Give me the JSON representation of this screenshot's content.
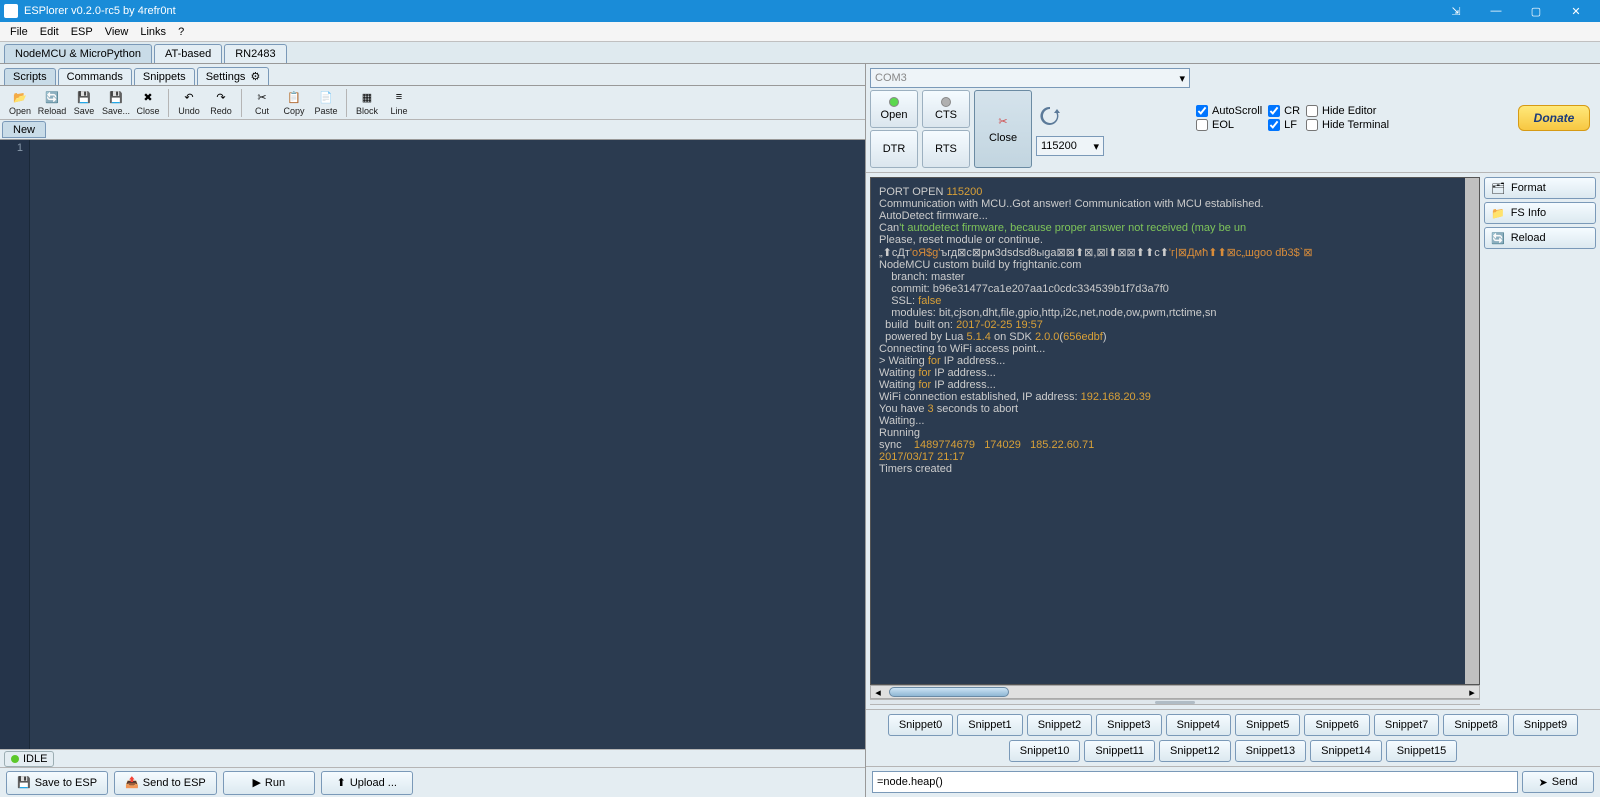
{
  "app": {
    "title": "ESPlorer v0.2.0-rc5 by 4refr0nt"
  },
  "menu": [
    "File",
    "Edit",
    "ESP",
    "View",
    "Links",
    "?"
  ],
  "main_tabs": [
    "NodeMCU & MicroPython",
    "AT-based",
    "RN2483"
  ],
  "sub_tabs": [
    "Scripts",
    "Commands",
    "Snippets",
    "Settings"
  ],
  "toolbar": [
    {
      "id": "open",
      "label": "Open"
    },
    {
      "id": "reload",
      "label": "Reload"
    },
    {
      "id": "save",
      "label": "Save"
    },
    {
      "id": "saveas",
      "label": "Save..."
    },
    {
      "id": "close",
      "label": "Close"
    },
    {
      "id": "undo",
      "label": "Undo"
    },
    {
      "id": "redo",
      "label": "Redo"
    },
    {
      "id": "cut",
      "label": "Cut"
    },
    {
      "id": "copy",
      "label": "Copy"
    },
    {
      "id": "paste",
      "label": "Paste"
    },
    {
      "id": "block",
      "label": "Block"
    },
    {
      "id": "line",
      "label": "Line"
    }
  ],
  "file_tab": "New",
  "editor": {
    "line_number": "1"
  },
  "status": "IDLE",
  "bottom_buttons": {
    "save_esp": "Save to ESP",
    "send_esp": "Send to ESP",
    "run": "Run",
    "upload": "Upload ..."
  },
  "serial": {
    "port": "COM3",
    "open": "Open",
    "cts": "CTS",
    "dtr": "DTR",
    "rts": "RTS",
    "close": "Close",
    "baud": "115200",
    "checks": {
      "autoscroll": "AutoScroll",
      "eol": "EOL",
      "cr": "CR",
      "lf": "LF",
      "hide_editor": "Hide Editor",
      "hide_terminal": "Hide Terminal"
    },
    "donate": "Donate"
  },
  "terminal_lines": [
    [
      [
        "",
        ""
      ]
    ],
    [
      [
        "",
        "PORT OPEN "
      ],
      [
        "c-yellow",
        "115200"
      ]
    ],
    [
      [
        "",
        ""
      ]
    ],
    [
      [
        "",
        "Communication with MCU..Got answer! Communication with MCU established."
      ]
    ],
    [
      [
        "",
        "AutoDetect firmware..."
      ]
    ],
    [
      [
        "",
        ""
      ]
    ],
    [
      [
        "",
        "Can"
      ],
      [
        "c-green",
        "'t autodetect firmware, because proper answer not received (may be un"
      ]
    ],
    [
      [
        "",
        "Please, reset module or continue."
      ]
    ],
    [
      [
        "",
        "„⬆сДт"
      ],
      [
        "c-orange",
        "'оЯ$g'"
      ],
      [
        "",
        "ъгд⊠с⊠рм3dsdsd8ыgа⊠⊠⬆⊠,⊠l⬆⊠⊠⬆⬆с⬆"
      ],
      [
        "c-orange",
        "'г|⊠Дмћ⬆⬆⊠с„шgoo dƀ3$`⊠"
      ]
    ],
    [
      [
        "",
        ""
      ]
    ],
    [
      [
        "",
        "NodeMCU custom build by frightanic.com"
      ]
    ],
    [
      [
        "",
        "    branch: master"
      ]
    ],
    [
      [
        "",
        "    commit: b96e31477ca1e207aa1c0cdc334539b1f7d3a7f0"
      ]
    ],
    [
      [
        "",
        "    SSL: "
      ],
      [
        "c-yellow",
        "false"
      ]
    ],
    [
      [
        "",
        "    modules: bit,cjson,dht,file,gpio,http,i2c,net,node,ow,pwm,rtctime,sn"
      ]
    ],
    [
      [
        "",
        "  build  built on: "
      ],
      [
        "c-yellow",
        "2017-02-25 19:57"
      ]
    ],
    [
      [
        "",
        "  powered by Lua "
      ],
      [
        "c-yellow",
        "5.1.4"
      ],
      [
        "",
        " on SDK "
      ],
      [
        "c-yellow",
        "2.0.0"
      ],
      [
        "",
        "("
      ],
      [
        "c-yellow",
        "656edbf"
      ],
      [
        "",
        ")"
      ]
    ],
    [
      [
        "",
        "Connecting to WiFi access point..."
      ]
    ],
    [
      [
        "",
        "> Waiting "
      ],
      [
        "c-yellow",
        "for"
      ],
      [
        "",
        " IP address..."
      ]
    ],
    [
      [
        "",
        "Waiting "
      ],
      [
        "c-yellow",
        "for"
      ],
      [
        "",
        " IP address..."
      ]
    ],
    [
      [
        "",
        "Waiting "
      ],
      [
        "c-yellow",
        "for"
      ],
      [
        "",
        " IP address..."
      ]
    ],
    [
      [
        "",
        "WiFi connection established, IP address: "
      ],
      [
        "c-yellow",
        "192.168.20.39"
      ]
    ],
    [
      [
        "",
        "You have "
      ],
      [
        "c-yellow",
        "3"
      ],
      [
        "",
        " seconds to abort"
      ]
    ],
    [
      [
        "",
        "Waiting..."
      ]
    ],
    [
      [
        "",
        "Running"
      ]
    ],
    [
      [
        "",
        "sync    "
      ],
      [
        "c-yellow",
        "1489774679   174029   185.22.60.71"
      ]
    ],
    [
      [
        "c-yellow",
        "2017/03/17 21:17"
      ]
    ],
    [
      [
        "",
        "Timers created"
      ]
    ]
  ],
  "side_buttons": {
    "format": "Format",
    "fsinfo": "FS Info",
    "reload": "Reload"
  },
  "snippets_row1": [
    "Snippet0",
    "Snippet1",
    "Snippet2",
    "Snippet3",
    "Snippet4",
    "Snippet5",
    "Snippet6",
    "Snippet7",
    "Snippet8",
    "Snippet9",
    "Snippet10",
    "Snippet11"
  ],
  "snippets_row2": [
    "Snippet12",
    "Snippet13",
    "Snippet14",
    "Snippet15"
  ],
  "command_input": "=node.heap()",
  "send_label": "Send"
}
